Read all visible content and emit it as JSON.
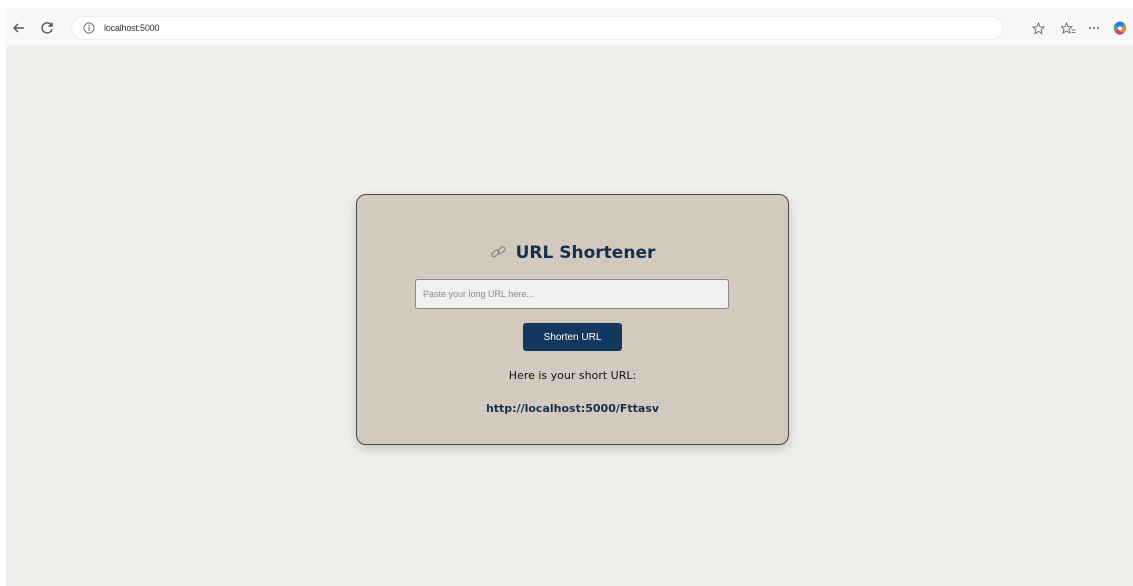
{
  "browser": {
    "url": "localhost:5000"
  },
  "app": {
    "title": "URL Shortener",
    "input_placeholder": "Paste your long URL here...",
    "input_value": "",
    "button_label": "Shorten URL",
    "result_label": "Here is your short URL:",
    "short_url": "http://localhost:5000/Fttasv"
  },
  "colors": {
    "page_background": "#efeeeb",
    "card_background": "#d4c9be",
    "accent": "#14375f",
    "title_text": "#15304f"
  },
  "icons": {
    "back": "back-arrow-icon",
    "reload": "reload-icon",
    "site_info": "info-icon",
    "favorite": "star-icon",
    "favorites_list": "favorites-icon",
    "more": "more-icon",
    "copilot": "copilot-icon",
    "title": "link-icon"
  }
}
